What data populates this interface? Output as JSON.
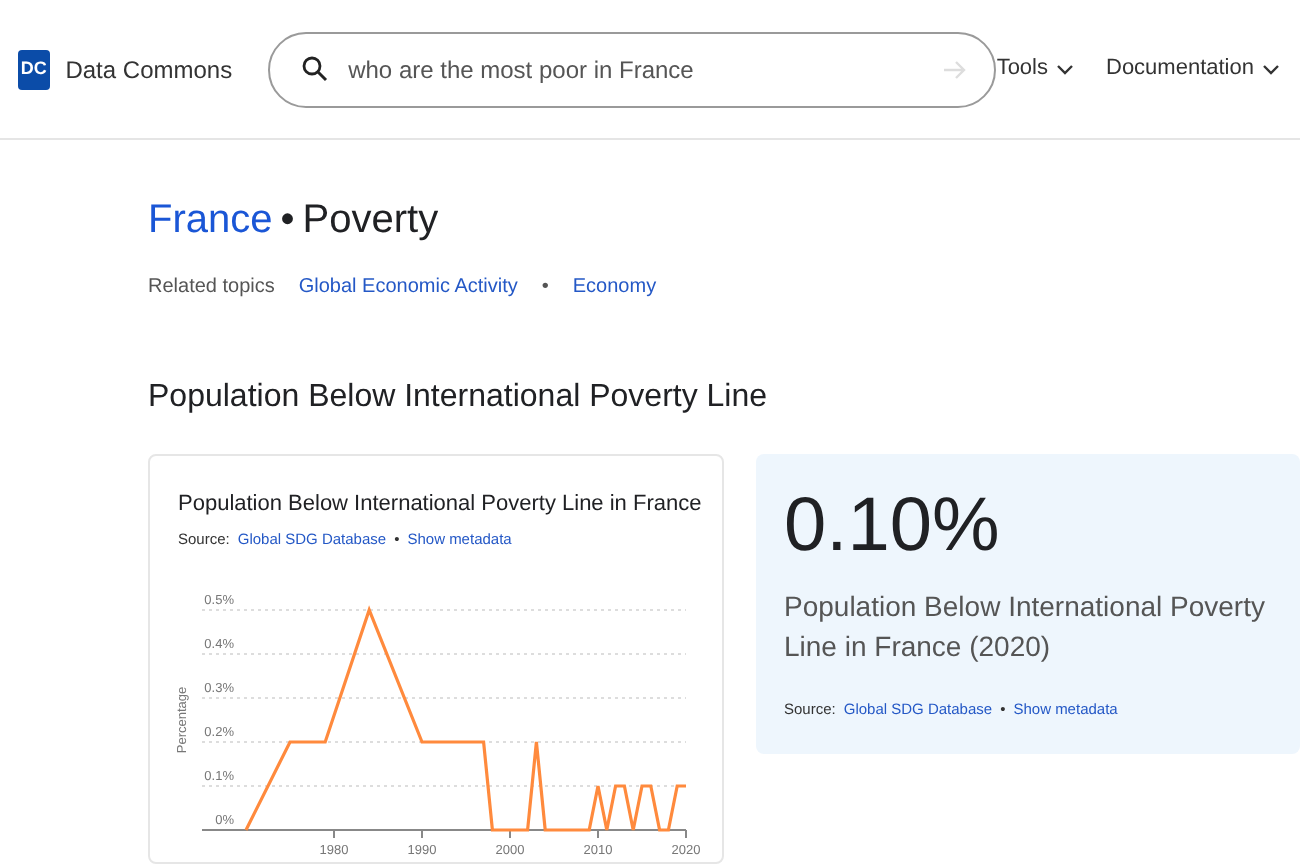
{
  "header": {
    "logo": "DC",
    "brand": "Data Commons",
    "search": {
      "value": "who are the most poor in France"
    },
    "nav": [
      "Tools",
      "Documentation"
    ]
  },
  "title": {
    "place": "France",
    "separator": "•",
    "topic": "Poverty"
  },
  "related": {
    "label": "Related topics",
    "links": [
      "Global Economic Activity",
      "Economy"
    ],
    "separator": "•"
  },
  "section_title": "Population Below International Poverty Line",
  "chart_card": {
    "title": "Population Below International Poverty Line in France",
    "source_label": "Source:",
    "source": "Global SDG Database",
    "separator": "•",
    "metadata": "Show metadata",
    "chart_data": {
      "type": "line",
      "ylabel": "Percentage",
      "x": [
        1970,
        1975,
        1979,
        1984,
        1990,
        1997,
        1998,
        2002,
        2003,
        2004,
        2009,
        2010,
        2011,
        2012,
        2013,
        2014,
        2015,
        2016,
        2017,
        2018,
        2019,
        2020
      ],
      "grid": true,
      "series": [
        {
          "color": "#ff8a3d",
          "values": [
            0,
            0.2,
            0.2,
            0.5,
            0.2,
            0.2,
            0,
            0,
            0.2,
            0,
            0,
            0.1,
            0,
            0.1,
            0.1,
            0,
            0.1,
            0.1,
            0,
            0,
            0.1,
            0.1
          ]
        }
      ],
      "xticks": [
        1980,
        1990,
        2000,
        2010,
        2020
      ],
      "yticks": [
        {
          "value": 0,
          "label": "0%"
        },
        {
          "value": 0.1,
          "label": "0.1%"
        },
        {
          "value": 0.2,
          "label": "0.2%"
        },
        {
          "value": 0.3,
          "label": "0.3%"
        },
        {
          "value": 0.4,
          "label": "0.4%"
        },
        {
          "value": 0.5,
          "label": "0.5%"
        }
      ],
      "ylim": [
        0,
        0.5
      ],
      "xlim": [
        1965,
        2020
      ]
    }
  },
  "highlight_card": {
    "value": "0.10%",
    "description": "Population Below International Poverty Line in France (2020)",
    "source_label": "Source:",
    "source": "Global SDG Database",
    "separator": "•",
    "metadata": "Show metadata"
  }
}
